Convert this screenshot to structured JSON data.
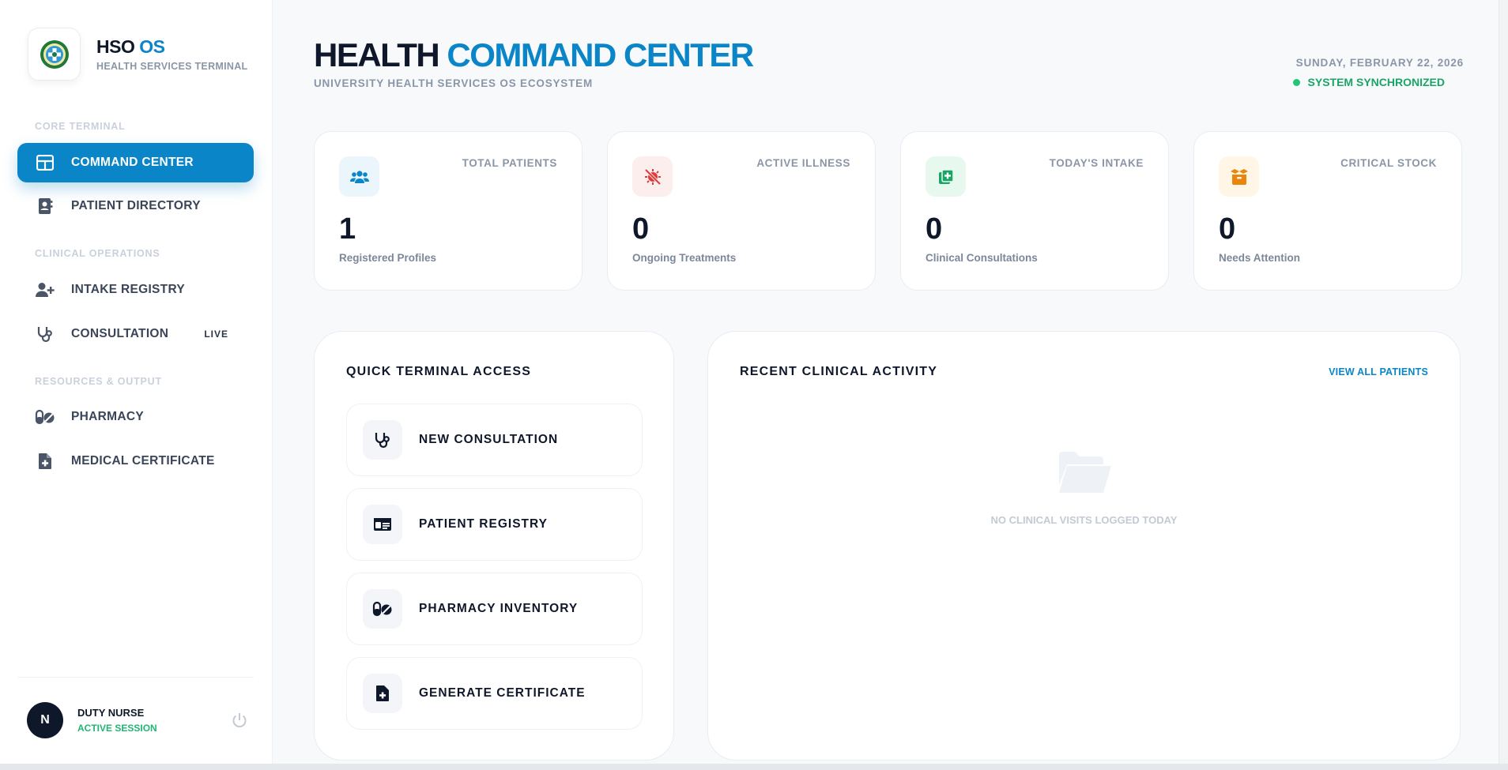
{
  "brand": {
    "title_main": "HSO",
    "title_accent": "OS",
    "subtitle": "HEALTH SERVICES TERMINAL"
  },
  "sidebar": {
    "sections": [
      "CORE TERMINAL",
      "CLINICAL OPERATIONS",
      "RESOURCES & OUTPUT"
    ],
    "items": [
      {
        "label": "COMMAND CENTER",
        "icon": "dashboard-grid-icon",
        "active": true
      },
      {
        "label": "PATIENT DIRECTORY",
        "icon": "contact-book-icon"
      },
      {
        "label": "INTAKE REGISTRY",
        "icon": "user-plus-icon"
      },
      {
        "label": "CONSULTATION",
        "icon": "stethoscope-icon",
        "badge": "LIVE"
      },
      {
        "label": "PHARMACY",
        "icon": "pills-icon"
      },
      {
        "label": "MEDICAL CERTIFICATE",
        "icon": "medical-file-icon"
      }
    ],
    "user": {
      "initial": "N",
      "name": "DUTY NURSE",
      "status": "ACTIVE SESSION"
    }
  },
  "header": {
    "title_main": "HEALTH",
    "title_accent": "COMMAND CENTER",
    "subtitle": "UNIVERSITY HEALTH SERVICES OS ECOSYSTEM",
    "date": "SUNDAY, FEBRUARY 22, 2026",
    "sync_status": "SYSTEM SYNCHRONIZED"
  },
  "stats": [
    {
      "label": "TOTAL PATIENTS",
      "value": "1",
      "desc": "Registered Profiles",
      "icon": "users-icon",
      "color": "#0a86c8",
      "bg": "#eaf5fc"
    },
    {
      "label": "ACTIVE ILLNESS",
      "value": "0",
      "desc": "Ongoing Treatments",
      "icon": "virus-slash-icon",
      "color": "#e03b3b",
      "bg": "#fdeeee"
    },
    {
      "label": "TODAY'S INTAKE",
      "value": "0",
      "desc": "Clinical Consultations",
      "icon": "add-files-icon",
      "color": "#1aa566",
      "bg": "#e7f8ef"
    },
    {
      "label": "CRITICAL STOCK",
      "value": "0",
      "desc": "Needs Attention",
      "icon": "box-open-icon",
      "color": "#e8860e",
      "bg": "#fff6e6"
    }
  ],
  "quick_access": {
    "title": "QUICK TERMINAL ACCESS",
    "items": [
      {
        "label": "NEW CONSULTATION",
        "icon": "stethoscope-icon"
      },
      {
        "label": "PATIENT REGISTRY",
        "icon": "id-card-icon"
      },
      {
        "label": "PHARMACY INVENTORY",
        "icon": "pills-icon"
      },
      {
        "label": "GENERATE CERTIFICATE",
        "icon": "medical-file-icon"
      }
    ]
  },
  "recent": {
    "title": "RECENT CLINICAL ACTIVITY",
    "view_all": "VIEW ALL PATIENTS",
    "empty_text": "NO CLINICAL VISITS LOGGED TODAY",
    "empty_icon": "folder-open-icon"
  }
}
